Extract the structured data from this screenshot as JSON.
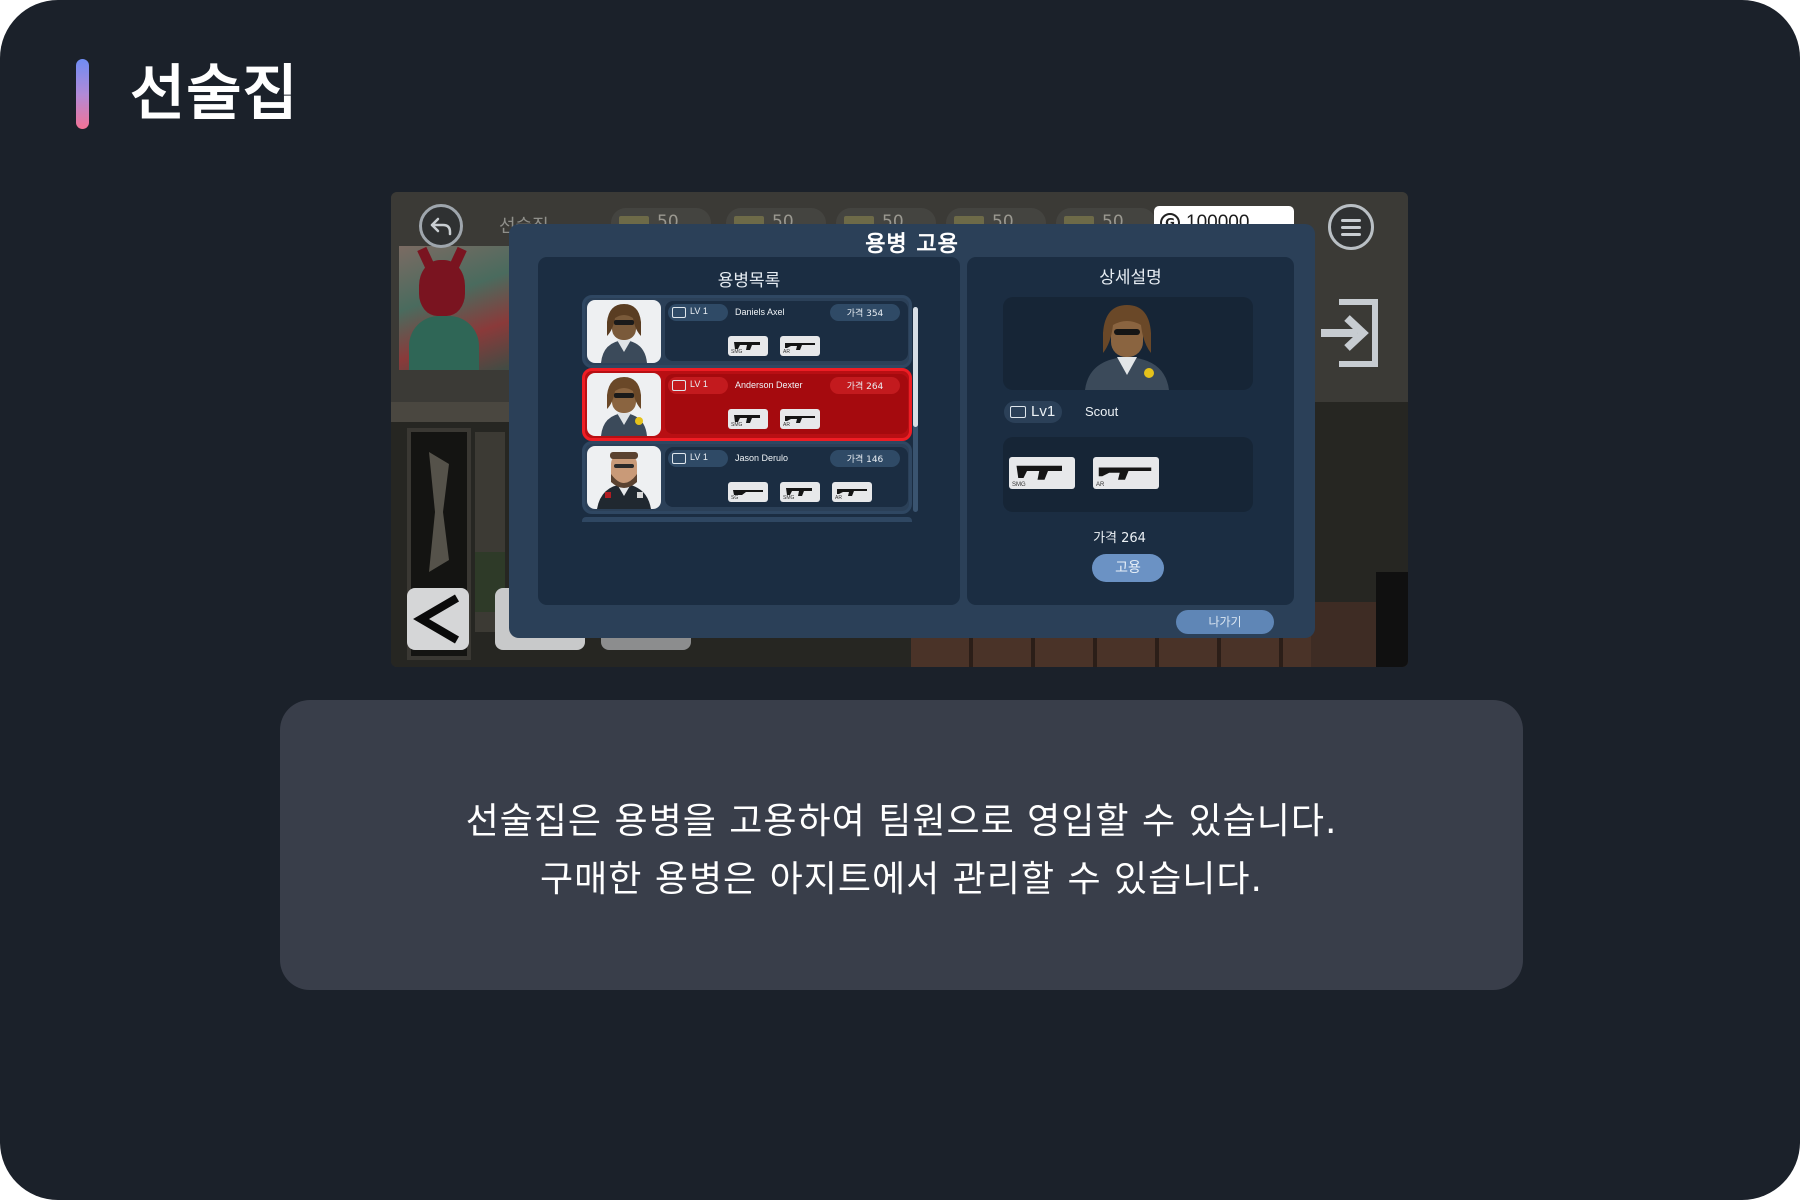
{
  "page": {
    "title": "선술집"
  },
  "game": {
    "top_menu_label": "선술집",
    "top_counters": [
      "50",
      "50",
      "50",
      "50",
      "50"
    ],
    "gold": "100000",
    "gold_symbol": "G",
    "modal": {
      "title": "용병 고용",
      "list_title": "용병목록",
      "detail_title": "상세설명",
      "mercenaries": [
        {
          "level": "LV 1",
          "name": "Daniels Axel",
          "price": "가격 354",
          "weapons": [
            "SMG",
            "AR"
          ],
          "selected": false
        },
        {
          "level": "LV 1",
          "name": "Anderson Dexter",
          "price": "가격 264",
          "weapons": [
            "SMG",
            "AR"
          ],
          "selected": true
        },
        {
          "level": "LV 1",
          "name": "Jason Derulo",
          "price": "가격 146",
          "weapons": [
            "SG",
            "SMG",
            "AR"
          ],
          "selected": false
        }
      ],
      "detail": {
        "level": "Lv1",
        "class": "Scout",
        "weapons": [
          "SMG",
          "AR"
        ],
        "price": "가격 264",
        "hire_label": "고용"
      },
      "exit_label": "나가기"
    }
  },
  "description": {
    "line1": "선술집은 용병을 고용하여 팀원으로 영입할 수 있습니다.",
    "line2": "구매한 용병은 아지트에서 관리할 수 있습니다."
  },
  "colors": {
    "background": "#1b212a",
    "modal": "#2b4058",
    "panel": "#1b2d42",
    "selected_row": "#b80f13",
    "hire_button": "#6b92c4",
    "description_box": "#393e4a"
  }
}
